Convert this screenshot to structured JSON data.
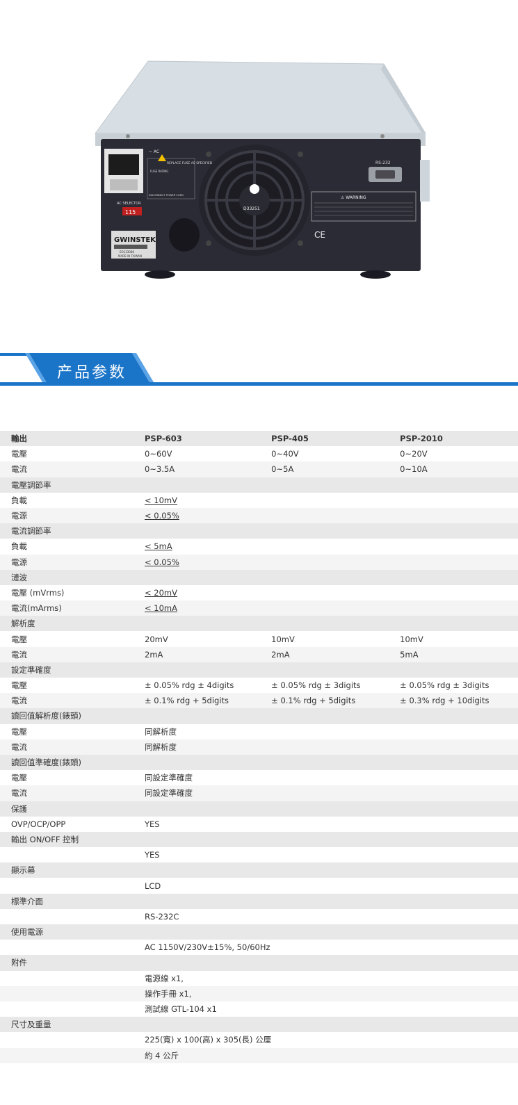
{
  "product_photo": {
    "labels": {
      "ac": "~ AC",
      "replace_fuse": "REPLACE FUSE AS SPECIFIED",
      "fuse_rating": "FUSE RATING",
      "disconnect": "DISCONNECT POWER CORD BEFORE REPLACING FUSE",
      "ac_selector": "AC SELECTOR",
      "ac_selector_value": "115",
      "brand": "GWINSTEK",
      "serial": "EO133088",
      "made_in": "MADE IN TAIWAN",
      "fan_label": "D33251",
      "rs232": "RS-232",
      "warning": "WARNING",
      "ce": "CE"
    },
    "colors": {
      "chassis_top": "#d5dde3",
      "chassis_panel": "#2a2a35",
      "background": "#ffffff"
    }
  },
  "section": {
    "title": "产品参数",
    "accent": "#1a74c8"
  },
  "spec_table": {
    "rows": [
      {
        "type": "hdr",
        "cells": [
          "輸出",
          "PSP-603",
          "PSP-405",
          "PSP-2010"
        ]
      },
      {
        "type": "row",
        "cells": [
          "電壓",
          "0~60V",
          "0~40V",
          "0~20V"
        ]
      },
      {
        "type": "row",
        "cells": [
          "電流",
          "0~3.5A",
          "0~5A",
          "0~10A"
        ]
      },
      {
        "type": "cat",
        "cells": [
          "電壓調節率",
          "",
          "",
          ""
        ]
      },
      {
        "type": "row",
        "cells": [
          "負載",
          "< 10mV",
          "",
          ""
        ],
        "ul": true
      },
      {
        "type": "row",
        "cells": [
          "電源",
          "< 0.05%",
          "",
          ""
        ],
        "ul": true
      },
      {
        "type": "cat",
        "cells": [
          "電流調節率",
          "",
          "",
          ""
        ]
      },
      {
        "type": "row",
        "cells": [
          "負載",
          "< 5mA",
          "",
          ""
        ],
        "ul": true
      },
      {
        "type": "row",
        "cells": [
          "電源",
          "< 0.05%",
          "",
          ""
        ],
        "ul": true
      },
      {
        "type": "cat",
        "cells": [
          "漣波",
          "",
          "",
          ""
        ]
      },
      {
        "type": "row",
        "cells": [
          "電壓 (mVrms)",
          "< 20mV",
          "",
          ""
        ],
        "ul": true
      },
      {
        "type": "row",
        "cells": [
          "電流(mArms)",
          "< 10mA",
          "",
          ""
        ],
        "ul": true
      },
      {
        "type": "cat",
        "cells": [
          "解析度",
          "",
          "",
          ""
        ]
      },
      {
        "type": "row",
        "cells": [
          "電壓",
          "20mV",
          "10mV",
          "10mV"
        ]
      },
      {
        "type": "row",
        "cells": [
          "電流",
          "2mA",
          "2mA",
          "5mA"
        ]
      },
      {
        "type": "cat",
        "cells": [
          "設定準確度",
          "",
          "",
          ""
        ]
      },
      {
        "type": "row",
        "cells": [
          "電壓",
          "± 0.05% rdg ± 4digits",
          "± 0.05% rdg ± 3digits",
          "± 0.05% rdg ± 3digits"
        ]
      },
      {
        "type": "row",
        "cells": [
          "電流",
          "± 0.1% rdg + 5digits",
          "± 0.1% rdg + 5digits",
          "± 0.3% rdg + 10digits"
        ]
      },
      {
        "type": "cat",
        "cells": [
          "讀回值解析度(錶頭)",
          "",
          "",
          ""
        ]
      },
      {
        "type": "row",
        "cells": [
          "電壓",
          "同解析度",
          "",
          ""
        ]
      },
      {
        "type": "row",
        "cells": [
          "電流",
          "同解析度",
          "",
          ""
        ]
      },
      {
        "type": "cat",
        "cells": [
          "讀回值準確度(錶頭)",
          "",
          "",
          ""
        ]
      },
      {
        "type": "row",
        "cells": [
          "電壓",
          "同設定準確度",
          "",
          ""
        ]
      },
      {
        "type": "row",
        "cells": [
          "電流",
          "同設定準確度",
          "",
          ""
        ]
      },
      {
        "type": "cat",
        "cells": [
          "保護",
          "",
          "",
          ""
        ]
      },
      {
        "type": "row",
        "cells": [
          "OVP/OCP/OPP",
          "YES",
          "",
          ""
        ]
      },
      {
        "type": "cat",
        "cells": [
          "輸出 ON/OFF 控制",
          "",
          "",
          ""
        ]
      },
      {
        "type": "row",
        "cells": [
          "",
          "YES",
          "",
          ""
        ]
      },
      {
        "type": "cat",
        "cells": [
          "顯示幕",
          "",
          "",
          ""
        ]
      },
      {
        "type": "row",
        "cells": [
          "",
          "LCD",
          "",
          ""
        ]
      },
      {
        "type": "cat",
        "cells": [
          "標準介面",
          "",
          "",
          ""
        ]
      },
      {
        "type": "row",
        "cells": [
          "",
          "RS-232C",
          "",
          ""
        ]
      },
      {
        "type": "cat",
        "cells": [
          "使用電源",
          "",
          "",
          ""
        ]
      },
      {
        "type": "row",
        "cells": [
          "",
          "AC 1150V/230V±15%, 50/60Hz",
          "",
          ""
        ]
      },
      {
        "type": "cat",
        "cells": [
          "附件",
          "",
          "",
          ""
        ]
      },
      {
        "type": "row",
        "cells": [
          "",
          "電源線 x1,",
          "",
          ""
        ]
      },
      {
        "type": "row",
        "cells": [
          "",
          "操作手冊 x1,",
          "",
          ""
        ]
      },
      {
        "type": "row",
        "cells": [
          "",
          "測試線 GTL-104 x1",
          "",
          ""
        ]
      },
      {
        "type": "cat",
        "cells": [
          "尺寸及重量",
          "",
          "",
          ""
        ]
      },
      {
        "type": "row",
        "cells": [
          "",
          "225(寬) x 100(高) x 305(長) 公厘",
          "",
          ""
        ]
      },
      {
        "type": "row",
        "cells": [
          "",
          "約 4 公斤",
          "",
          ""
        ]
      }
    ]
  }
}
